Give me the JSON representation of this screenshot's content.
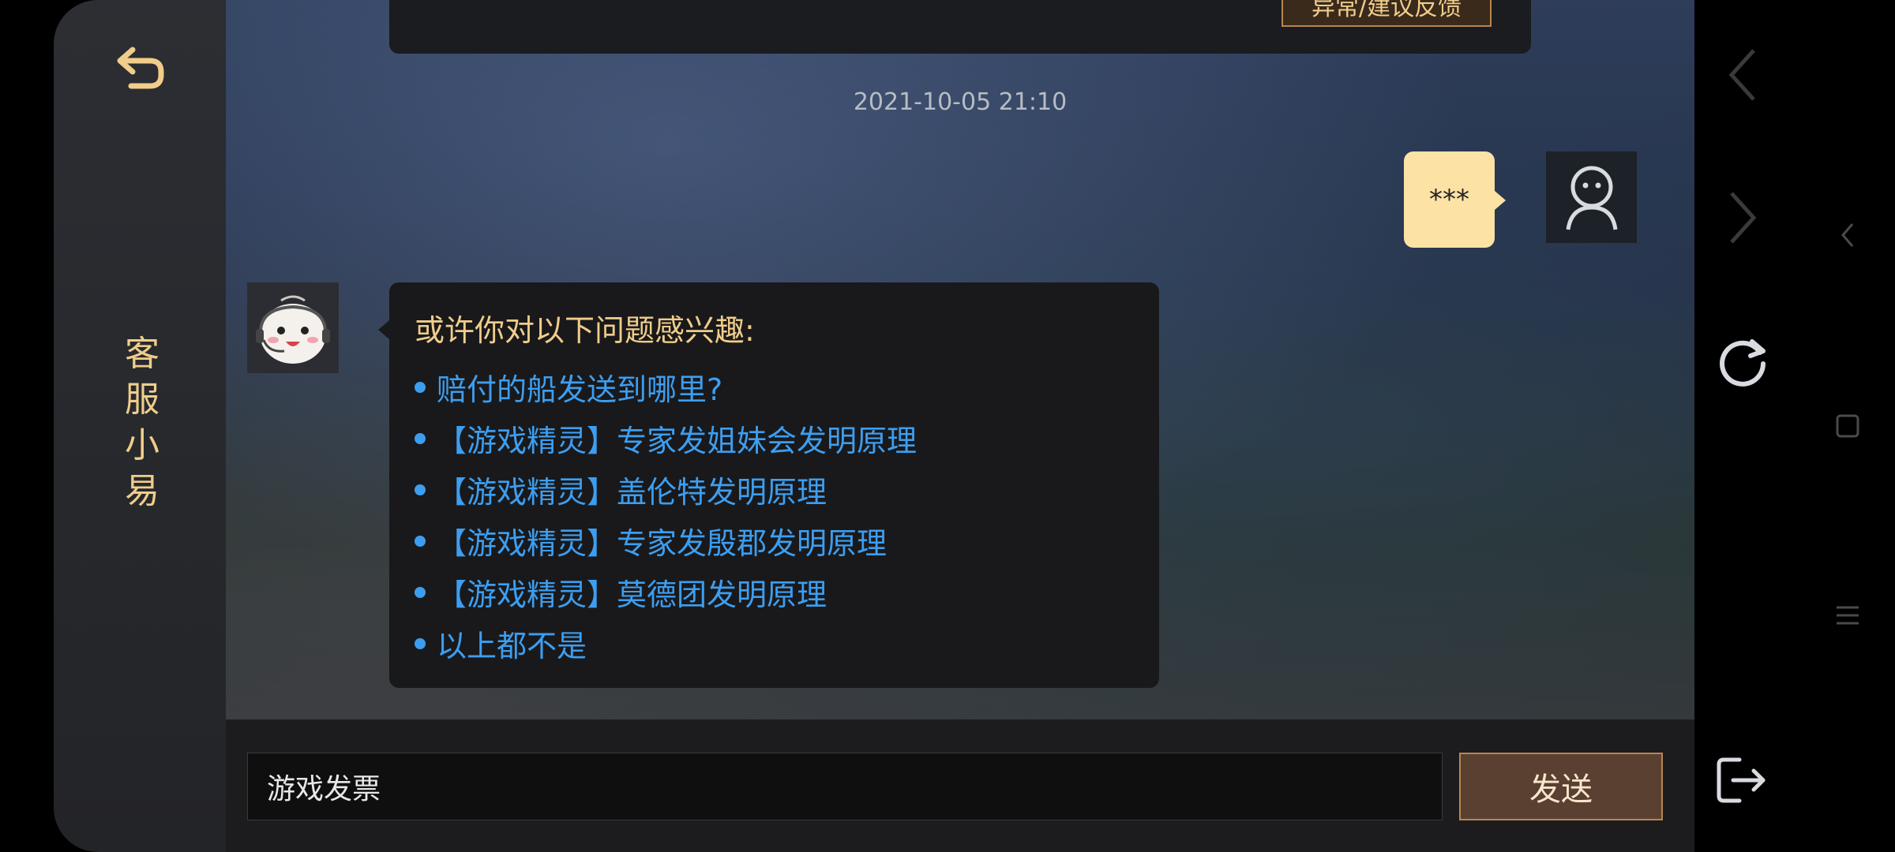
{
  "sidebar": {
    "title": "客\n服\n小\n易",
    "back_icon": "back-arrow-icon"
  },
  "chat": {
    "prev_message": {
      "feedback_button": "异常/建议反馈"
    },
    "timestamp": "2021-10-05 21:10",
    "user_message": "***",
    "bot_message": {
      "heading": "或许你对以下问题感兴趣:",
      "options": [
        "赔付的船发送到哪里?",
        "【游戏精灵】专家发姐妹会发明原理",
        "【游戏精灵】盖伦特发明原理",
        "【游戏精灵】专家发殷郡发明原理",
        "【游戏精灵】莫德团发明原理",
        "以上都不是"
      ]
    }
  },
  "input": {
    "value": "游戏发票",
    "send_label": "发送"
  },
  "colors": {
    "accent_gold": "#f0cd8a",
    "link_blue": "#3d9ef0",
    "user_bubble": "#fde2a5",
    "send_button": "#5a4030"
  }
}
